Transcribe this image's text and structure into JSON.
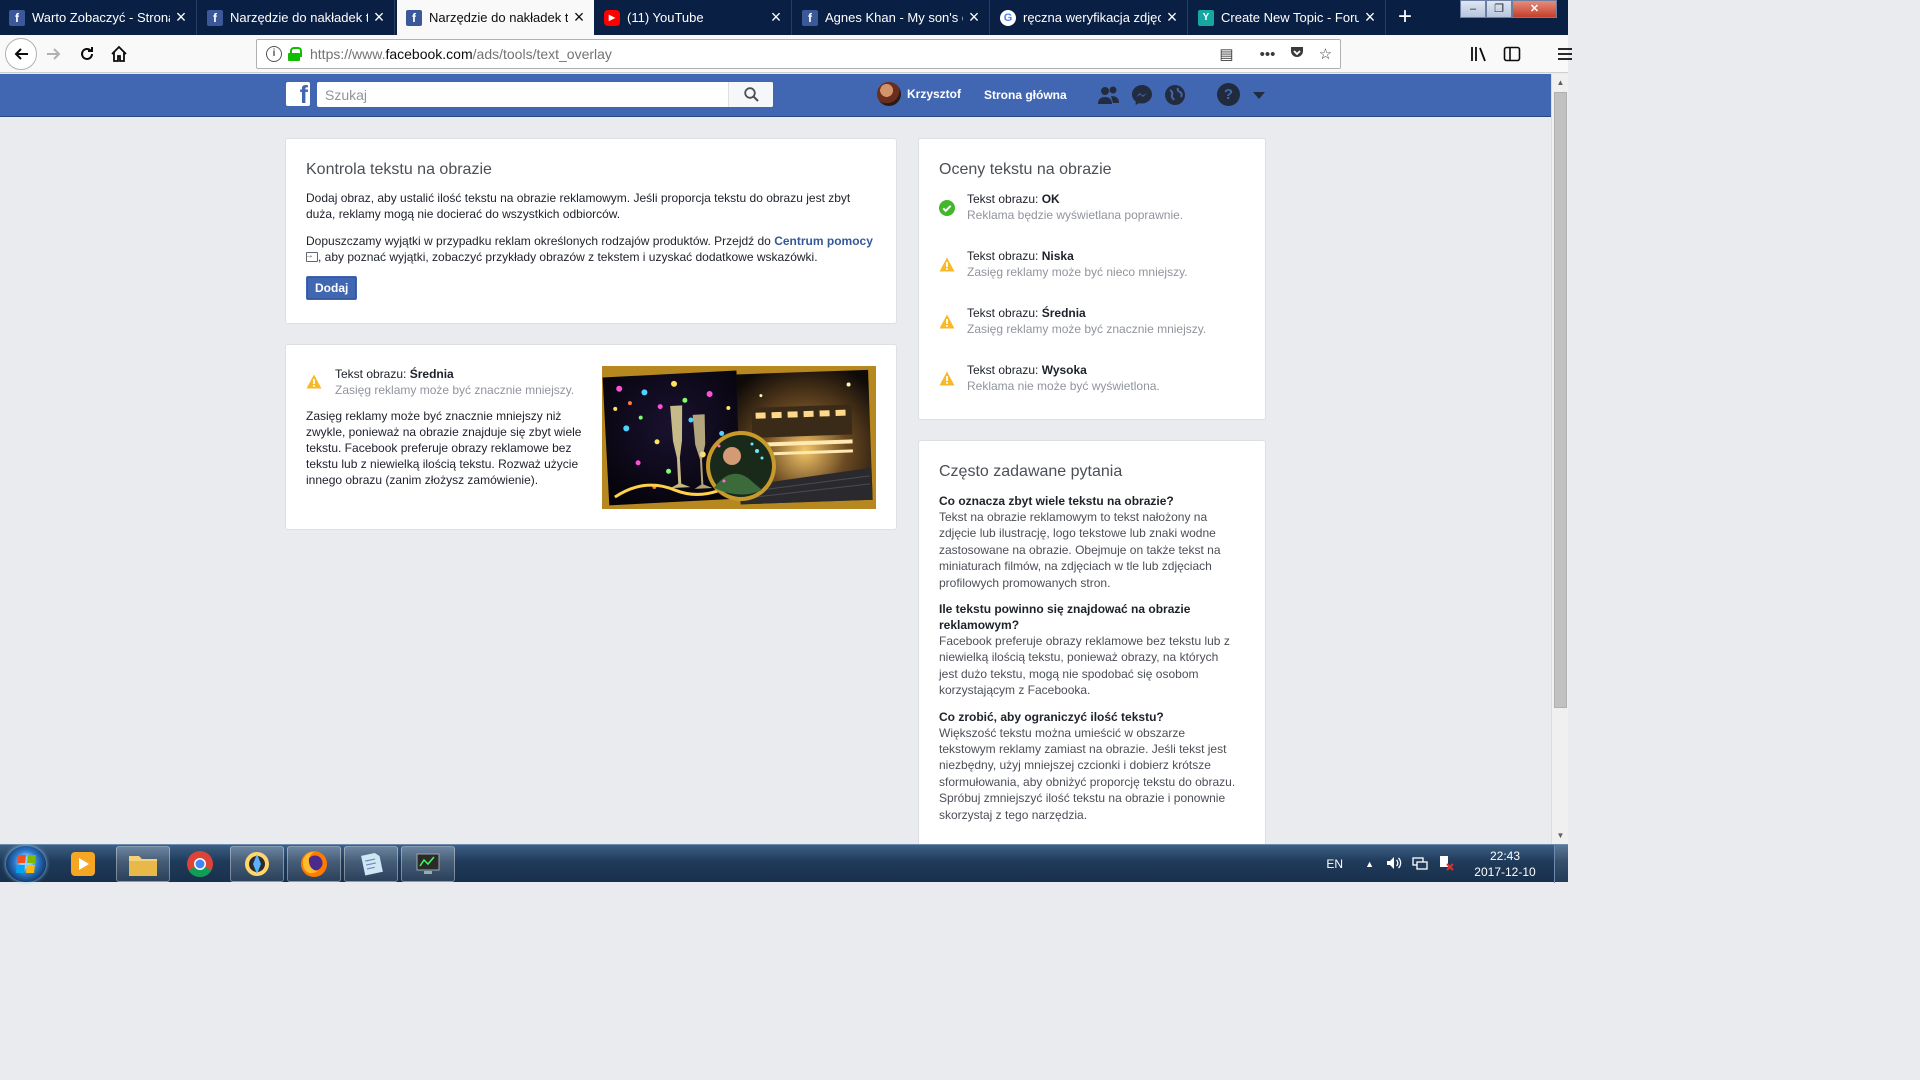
{
  "browser": {
    "tabs": [
      {
        "label": "Warto Zobaczyć - Strona",
        "favicon": "facebook-icon",
        "active": false
      },
      {
        "label": "Narzędzie do nakładek te",
        "favicon": "facebook-icon",
        "active": false
      },
      {
        "label": "Narzędzie do nakładek te",
        "favicon": "facebook-icon",
        "active": true
      },
      {
        "label": "(11) YouTube",
        "favicon": "youtube-icon",
        "active": false
      },
      {
        "label": "Agnes Khan - My son's co",
        "favicon": "facebook-icon",
        "active": false
      },
      {
        "label": "ręczna weryfikacja zdjęcia",
        "favicon": "google-icon",
        "active": false
      },
      {
        "label": "Create New Topic - Forum",
        "favicon": "pinned-site-icon",
        "active": false
      }
    ],
    "url_prefix": "https://www.",
    "url_domain": "facebook.com",
    "url_path": "/ads/tools/text_overlay"
  },
  "fb_header": {
    "search_placeholder": "Szukaj",
    "user_name": "Krzysztof",
    "home_label": "Strona główna",
    "help_glyph": "?"
  },
  "text_check": {
    "title": "Kontrola tekstu na obrazie",
    "intro": "Dodaj obraz, aby ustalić ilość tekstu na obrazie reklamowym. Jeśli proporcja tekstu do obrazu jest zbyt duża, reklamy mogą nie docierać do wszystkich odbiorców.",
    "exceptions_before": "Dopuszczamy wyjątki w przypadku reklam określonych rodzajów produktów. Przejdź do ",
    "exceptions_link": "Centrum pomocy",
    "exceptions_after": ", aby poznać wyjątki, zobaczyć przykłady obrazów z tekstem i uzyskać dodatkowe wskazówki.",
    "add_button": "Dodaj"
  },
  "result": {
    "label": "Tekst obrazu:",
    "value": "Średnia",
    "subtitle": "Zasięg reklamy może być znacznie mniejszy.",
    "description": "Zasięg reklamy może być znacznie mniejszy niż zwykle, ponieważ na obrazie znajduje się zbyt wiele tekstu. Facebook preferuje obrazy reklamowe bez tekstu lub z niewielką ilością tekstu. Rozważ użycie innego obrazu (zanim złożysz zamówienie)."
  },
  "ratings": {
    "title": "Oceny tekstu na obrazie",
    "items": [
      {
        "label": "Tekst obrazu:",
        "value": "OK",
        "desc": "Reklama będzie wyświetlana poprawnie.",
        "icon": "check-circle-icon"
      },
      {
        "label": "Tekst obrazu:",
        "value": "Niska",
        "desc": "Zasięg reklamy może być nieco mniejszy.",
        "icon": "warning-icon"
      },
      {
        "label": "Tekst obrazu:",
        "value": "Średnia",
        "desc": "Zasięg reklamy może być znacznie mniejszy.",
        "icon": "warning-icon"
      },
      {
        "label": "Tekst obrazu:",
        "value": "Wysoka",
        "desc": "Reklama nie może być wyświetlona.",
        "icon": "warning-icon"
      }
    ]
  },
  "faq": {
    "title": "Często zadawane pytania",
    "items": [
      {
        "q": "Co oznacza zbyt wiele tekstu na obrazie?",
        "a": "Tekst na obrazie reklamowym to tekst nałożony na zdjęcie lub ilustrację, logo tekstowe lub znaki wodne zastosowane na obrazie. Obejmuje on także tekst na miniaturach filmów, na zdjęciach w tle lub zdjęciach profilowych promowanych stron."
      },
      {
        "q": "Ile tekstu powinno się znajdować na obrazie reklamowym?",
        "a": "Facebook preferuje obrazy reklamowe bez tekstu lub z niewielką ilością tekstu, ponieważ obrazy, na których jest dużo tekstu, mogą nie spodobać się osobom korzystającym z Facebooka."
      },
      {
        "q": "Co zrobić, aby ograniczyć ilość tekstu?",
        "a": "Większość tekstu można umieścić w obszarze tekstowym reklamy zamiast na obrazie. Jeśli tekst jest niezbędny, użyj mniejszej czcionki i dobierz krótsze sformułowania, aby obniżyć proporcję tekstu do obrazu. Spróbuj zmniejszyć ilość tekstu na obrazie i ponownie skorzystaj z tego narzędzia."
      }
    ]
  },
  "taskbar": {
    "language": "EN",
    "time": "22:43",
    "date": "2017-12-10"
  },
  "colors": {
    "facebook_blue": "#4267b2",
    "warning_yellow": "#f7b928",
    "ok_green": "#42b72a",
    "link_blue": "#365899"
  }
}
